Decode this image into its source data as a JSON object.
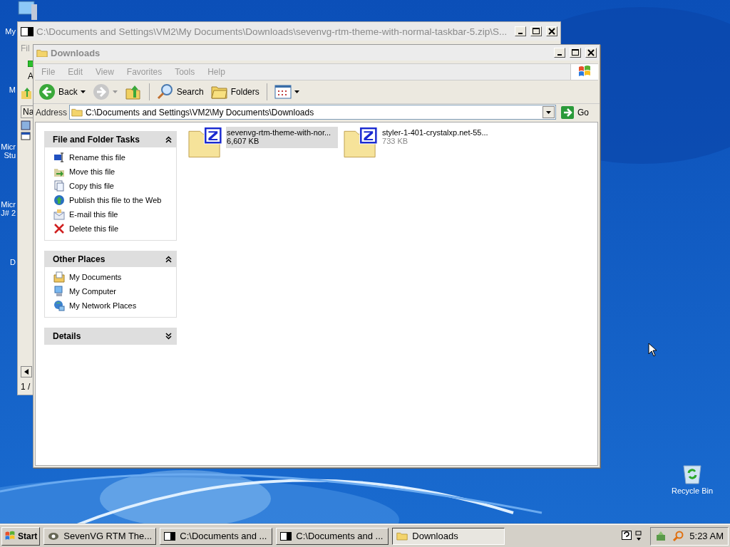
{
  "desktop_icons": [
    {
      "lines": [
        "My"
      ]
    },
    {
      "lines": [
        "M"
      ]
    },
    {
      "lines": [
        "Micr",
        "Stu"
      ]
    },
    {
      "lines": [
        "Micr",
        "J# 2"
      ]
    },
    {
      "lines": [
        "D"
      ]
    }
  ],
  "recycle_bin": {
    "label": "Recycle Bin"
  },
  "archive_window": {
    "title": "C:\\Documents and Settings\\VM2\\My Documents\\Downloads\\sevenvg-rtm-theme-with-normal-taskbar-5.zip\\S...",
    "menu": "Fil",
    "toolbar_label": "A",
    "column": "Na",
    "status": "1 /"
  },
  "explorer": {
    "title": "Downloads",
    "menu": [
      "File",
      "Edit",
      "View",
      "Favorites",
      "Tools",
      "Help"
    ],
    "toolbar": [
      {
        "kind": "back",
        "label": "Back"
      },
      {
        "kind": "forward"
      },
      {
        "kind": "up"
      },
      {
        "kind": "search",
        "label": "Search"
      },
      {
        "kind": "folders",
        "label": "Folders"
      },
      {
        "kind": "views"
      }
    ],
    "address_label": "Address",
    "address": "C:\\Documents and Settings\\VM2\\My Documents\\Downloads",
    "go": "Go",
    "panels": [
      {
        "title": "File and Folder Tasks",
        "expanded": true,
        "items": [
          {
            "kind": "rename",
            "label": "Rename this file"
          },
          {
            "kind": "move",
            "label": "Move this file"
          },
          {
            "kind": "copy",
            "label": "Copy this file"
          },
          {
            "kind": "publish",
            "label": "Publish this file to the Web"
          },
          {
            "kind": "email",
            "label": "E-mail this file"
          },
          {
            "kind": "delete",
            "label": "Delete this file"
          }
        ]
      },
      {
        "title": "Other Places",
        "expanded": true,
        "items": [
          {
            "kind": "documents",
            "label": "My Documents"
          },
          {
            "kind": "computer",
            "label": "My Computer"
          },
          {
            "kind": "network",
            "label": "My Network Places"
          }
        ]
      },
      {
        "title": "Details",
        "expanded": false
      }
    ],
    "files": [
      {
        "name": "sevenvg-rtm-theme-with-nor...",
        "size": "6,607 KB",
        "selected": true
      },
      {
        "name": "styler-1-401-crystalxp.net-55...",
        "size": "733 KB",
        "selected": false
      }
    ]
  },
  "taskbar": {
    "start": "Start",
    "buttons": [
      {
        "kind": "app",
        "label": "SevenVG RTM The...",
        "selected": false
      },
      {
        "kind": "archive",
        "label": "C:\\Documents and ...",
        "selected": false
      },
      {
        "kind": "archive",
        "label": "C:\\Documents and ...",
        "selected": false
      },
      {
        "kind": "folder",
        "label": "Downloads",
        "selected": true
      }
    ],
    "clock": "5:23 AM"
  }
}
